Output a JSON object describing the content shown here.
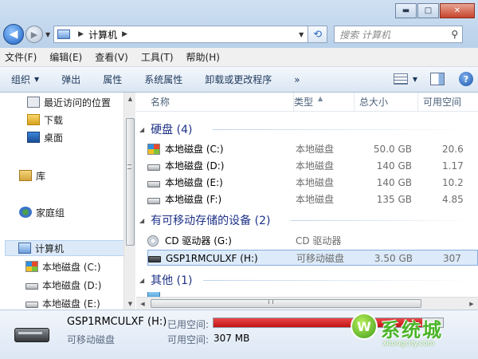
{
  "window": {
    "minimize_glyph": "▬",
    "maximize_glyph": "□",
    "close_glyph": "✕"
  },
  "address": {
    "back_glyph": "◀",
    "forward_glyph": "▶",
    "crumb": "计算机",
    "search_placeholder": "搜索 计算机"
  },
  "menu": [
    "文件(F)",
    "编辑(E)",
    "查看(V)",
    "工具(T)",
    "帮助(H)"
  ],
  "toolbar": {
    "organize": "组织",
    "eject": "弹出",
    "properties": "属性",
    "system_properties": "系统属性",
    "uninstall": "卸载或更改程序",
    "more": "»",
    "help": "?"
  },
  "sidebar": {
    "items": [
      {
        "label": "最近访问的位置"
      },
      {
        "label": "下载"
      },
      {
        "label": "桌面"
      },
      {
        "label": "库"
      },
      {
        "label": "家庭组"
      },
      {
        "label": "计算机"
      },
      {
        "label": "本地磁盘 (C:)"
      },
      {
        "label": "本地磁盘 (D:)"
      },
      {
        "label": "本地磁盘 (E:)"
      }
    ]
  },
  "columns": {
    "name": "名称",
    "type": "类型",
    "total": "总大小",
    "free": "可用空间"
  },
  "groups": [
    {
      "title": "硬盘 (4)",
      "rows": [
        {
          "name": "本地磁盘 (C:)",
          "type": "本地磁盘",
          "total": "50.0 GB",
          "free": "20.6",
          "icon": "windows-drive-icon"
        },
        {
          "name": "本地磁盘 (D:)",
          "type": "本地磁盘",
          "total": "140 GB",
          "free": "1.17",
          "icon": "hard-drive-icon"
        },
        {
          "name": "本地磁盘 (E:)",
          "type": "本地磁盘",
          "total": "140 GB",
          "free": "10.2",
          "icon": "hard-drive-icon"
        },
        {
          "name": "本地磁盘 (F:)",
          "type": "本地磁盘",
          "total": "135 GB",
          "free": "4.85",
          "icon": "hard-drive-icon"
        }
      ]
    },
    {
      "title": "有可移动存储的设备 (2)",
      "rows": [
        {
          "name": "CD 驱动器 (G:)",
          "type": "CD 驱动器",
          "total": "",
          "free": "",
          "icon": "cd-drive-icon"
        },
        {
          "name": "GSP1RMCULXF (H:)",
          "type": "可移动磁盘",
          "total": "3.50 GB",
          "free": "307",
          "icon": "usb-drive-icon",
          "selected": true
        }
      ]
    },
    {
      "title": "其他 (1)",
      "rows": []
    }
  ],
  "details": {
    "name": "GSP1RMCULXF (H:)",
    "type": "可移动磁盘",
    "used_label": "已用空间:",
    "free_label": "可用空间:",
    "free_value": "307 MB",
    "used_fraction": 0.91,
    "used_color": "#d11a1c"
  },
  "watermark": {
    "text": "系统城",
    "sub": "xitongcity.com"
  }
}
